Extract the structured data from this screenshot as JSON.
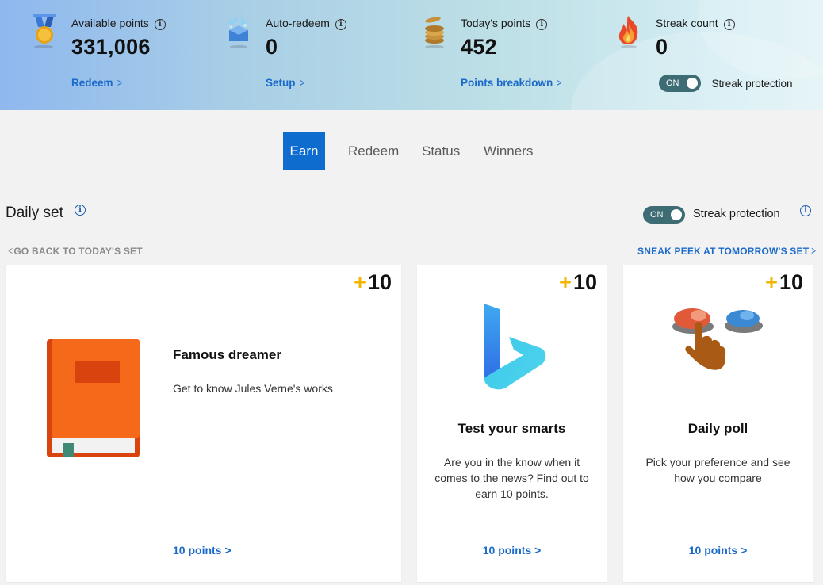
{
  "stats": [
    {
      "label": "Available points",
      "value": "331,006",
      "link": "Redeem",
      "icon": "medal-icon"
    },
    {
      "label": "Auto-redeem",
      "value": "0",
      "link": "Setup",
      "icon": "gift-box-icon"
    },
    {
      "label": "Today's points",
      "value": "452",
      "link": "Points breakdown",
      "icon": "coin-stack-icon"
    },
    {
      "label": "Streak count",
      "value": "0",
      "icon": "flame-icon"
    }
  ],
  "header_streak": {
    "toggle_text": "ON",
    "label": "Streak protection"
  },
  "tabs": [
    {
      "label": "Earn",
      "active": true
    },
    {
      "label": "Redeem"
    },
    {
      "label": "Status"
    },
    {
      "label": "Winners"
    }
  ],
  "daily_set": {
    "title": "Daily set",
    "streak_toggle_text": "ON",
    "streak_label": "Streak protection",
    "back_link": "GO BACK TO TODAY'S SET",
    "forward_link": "SNEAK PEEK AT TOMORROW'S SET"
  },
  "cards": [
    {
      "points_plus": "+",
      "points": "10",
      "title": "Famous dreamer",
      "description": "Get to know Jules Verne's works",
      "link": "10 points >",
      "icon": "book-icon"
    },
    {
      "points_plus": "+",
      "points": "10",
      "title": "Test your smarts",
      "description": "Are you in the know when it comes to the news? Find out to earn 10 points.",
      "link": "10 points >",
      "icon": "bing-logo-icon"
    },
    {
      "points_plus": "+",
      "points": "10",
      "title": "Daily poll",
      "description": "Pick your preference and see how you compare",
      "link": "10 points >",
      "icon": "poll-buttons-icon"
    }
  ],
  "colors": {
    "accent": "#0f6ccf",
    "link": "#1b6ac9",
    "plus": "#f2b600",
    "toggle": "#3e6c75"
  }
}
